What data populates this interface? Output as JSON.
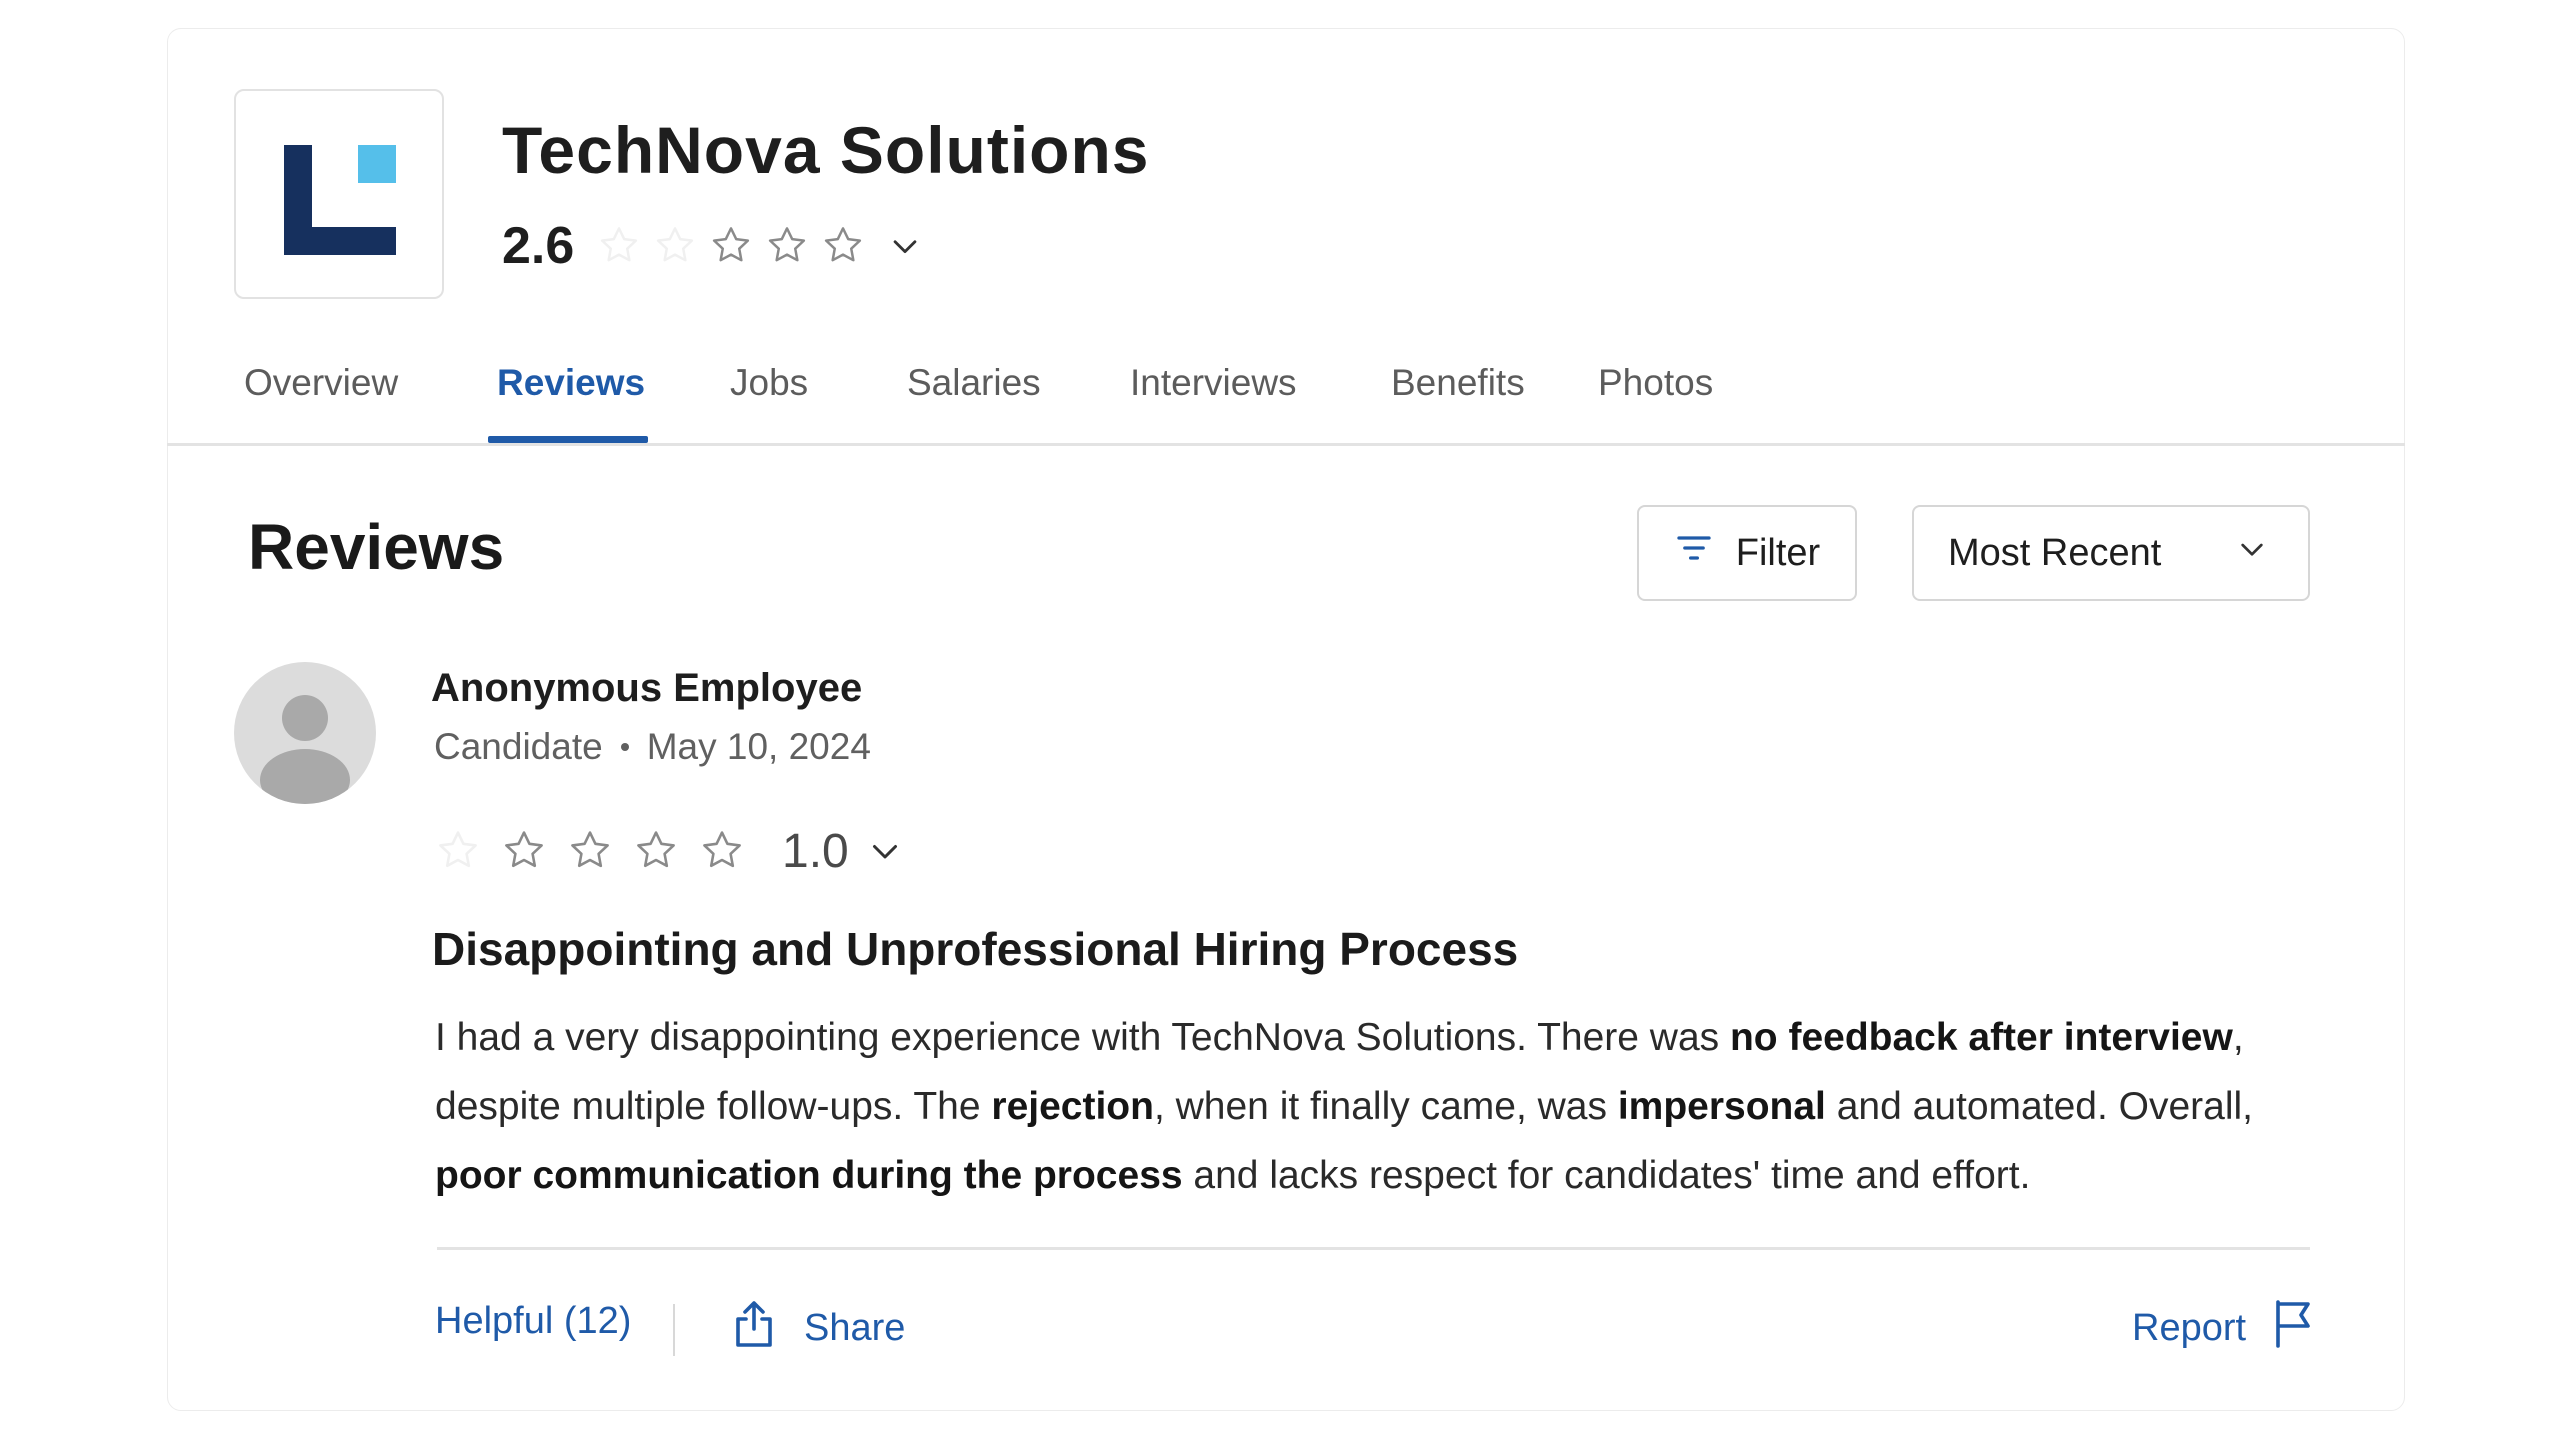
{
  "company": {
    "name": "TechNova Solutions",
    "rating": "2.6",
    "rating_value": 2.6,
    "logo_colors": {
      "dark": "#16305e",
      "accent": "#55bfea"
    }
  },
  "tabs": [
    {
      "label": "Overview",
      "active": false
    },
    {
      "label": "Reviews",
      "active": true
    },
    {
      "label": "Jobs",
      "active": false
    },
    {
      "label": "Salaries",
      "active": false
    },
    {
      "label": "Interviews",
      "active": false
    },
    {
      "label": "Benefits",
      "active": false
    },
    {
      "label": "Photos",
      "active": false
    }
  ],
  "reviews_section": {
    "title": "Reviews",
    "filter_label": "Filter",
    "sort_label": "Most Recent"
  },
  "review": {
    "author": "Anonymous Employee",
    "role": "Candidate",
    "date": "May 10, 2024",
    "rating": "1.0",
    "rating_value": 1.0,
    "title": "Disappointing and Unprofessional Hiring Process",
    "body": {
      "p1": "I had a very disappointing experience with TechNova Solutions. There was ",
      "b1": "no feedback after interview",
      "p2": ", despite multiple follow-ups. The ",
      "b2": "rejection",
      "p3": ", when it finally came, was ",
      "b3": "impersonal",
      "p4": " and automated. Overall, ",
      "b4": "poor communication during the process",
      "p5": " and lacks respect for candidates' time and effort."
    },
    "helpful_label": "Helpful (12)",
    "share_label": "Share",
    "report_label": "Report"
  },
  "colors": {
    "accent": "#1f5aa8",
    "text": "#1e1e1e",
    "muted": "#606060",
    "border": "#d6d6d6"
  },
  "icons": {
    "filter": "filter-icon",
    "sort": "chevron-down-icon",
    "share": "share-icon",
    "report": "flag-icon",
    "star": "star-outline-icon",
    "avatar": "user-silhouette-icon"
  }
}
